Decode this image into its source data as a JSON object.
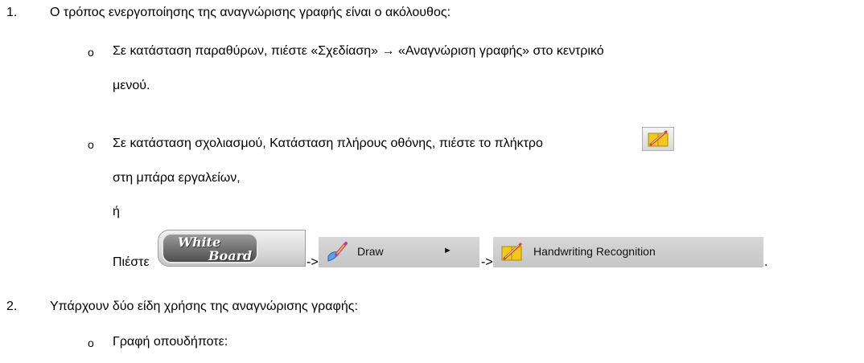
{
  "list": [
    {
      "number": "1.",
      "text": "Ο τρόπος ενεργοποίησης της αναγνώρισης γραφής είναι ο ακόλουθος:",
      "bullets": [
        {
          "marker": "o",
          "line1": "Σε κατάσταση παραθύρων, πιέστε «Σχεδίαση» → «Αναγνώριση γραφής» στο κεντρικό",
          "line2": "μενού."
        },
        {
          "marker": "o",
          "line1": "Σε κατάσταση σχολιασμού, Κατάσταση πλήρους οθόνης, πιέστε το πλήκτρο",
          "line2": "στη μπάρα εργαλείων,",
          "line3": "ή",
          "press_label": "Πιέστε",
          "arrow1": "->",
          "arrow2": "->",
          "period": "."
        }
      ]
    },
    {
      "number": "2.",
      "text": "Υπάρχουν δύο είδη χρήσης της αναγνώρισης γραφής:",
      "bullets": [
        {
          "marker": "o",
          "line1": "Γραφή οπουδήποτε:"
        }
      ]
    }
  ],
  "ui": {
    "whiteboard": {
      "line1": "White",
      "line2": "Board"
    },
    "draw_menu": {
      "label": "Draw",
      "submenu_arrow": "►"
    },
    "handwriting_menu": {
      "label": "Handwriting Recognition"
    }
  },
  "icons": {
    "toolbar": "handwriting-recognition-icon",
    "draw": "draw-brush-icon",
    "handwriting": "handwriting-recognition-icon"
  },
  "colors": {
    "menu_bg": "#cccccc",
    "icon_yellow": "#f3c81c",
    "icon_red": "#d8432c"
  }
}
